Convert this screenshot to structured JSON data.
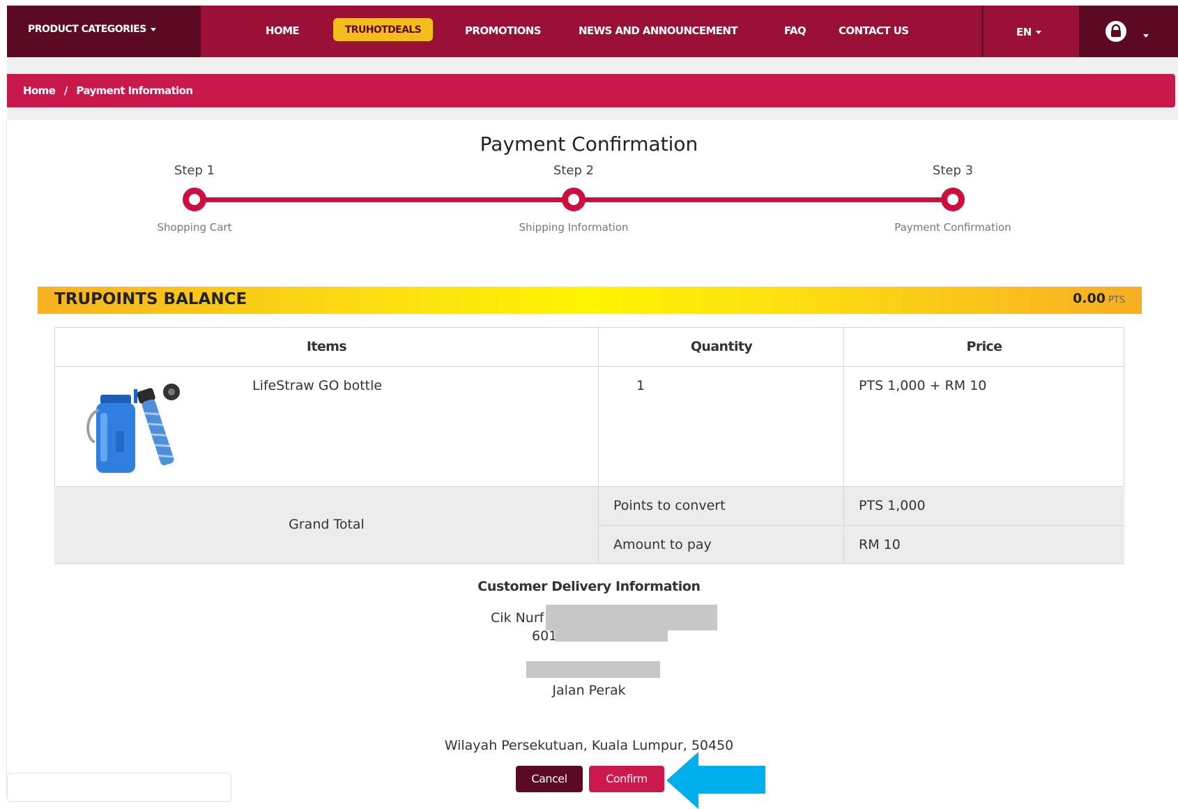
{
  "navbar": {
    "product_categories": "PRODUCT CATEGORIES",
    "items": [
      "HOME",
      "TRUHOTDEALS",
      "PROMOTIONS",
      "NEWS AND ANNOUNCEMENT",
      "FAQ",
      "CONTACT US"
    ],
    "language": "EN",
    "colors": {
      "primary": "#9b1035",
      "dark": "#5c0a24",
      "highlight": "#f5bc1d"
    }
  },
  "breadcrumb": {
    "home": "Home",
    "separator": "/",
    "current": "Payment Information"
  },
  "page_title": "Payment Confirmation",
  "steps": [
    {
      "label": "Step 1",
      "sub": "Shopping Cart"
    },
    {
      "label": "Step 2",
      "sub": "Shipping Information"
    },
    {
      "label": "Step 3",
      "sub": "Payment Confirmation"
    }
  ],
  "balance": {
    "label": "TRUPOINTS BALANCE",
    "value": "0.00",
    "unit": "PTS"
  },
  "table": {
    "headers": {
      "items": "Items",
      "quantity": "Quantity",
      "price": "Price"
    },
    "row": {
      "item": "LifeStraw GO bottle",
      "quantity": "1",
      "price": "PTS 1,000 +  RM 10"
    },
    "grand_total": {
      "label": "Grand Total",
      "points_label": "Points to convert",
      "points_value": "PTS 1,000",
      "pay_label": "Amount to pay",
      "pay_value": "RM 10"
    }
  },
  "delivery": {
    "title": "Customer Delivery Information",
    "name_visible": "Cik Nurf",
    "phone_visible": "601",
    "street": "Jalan Perak",
    "region": "Wilayah Persekutuan, Kuala Lumpur, 50450"
  },
  "buttons": {
    "cancel": "Cancel",
    "confirm": "Confirm"
  }
}
